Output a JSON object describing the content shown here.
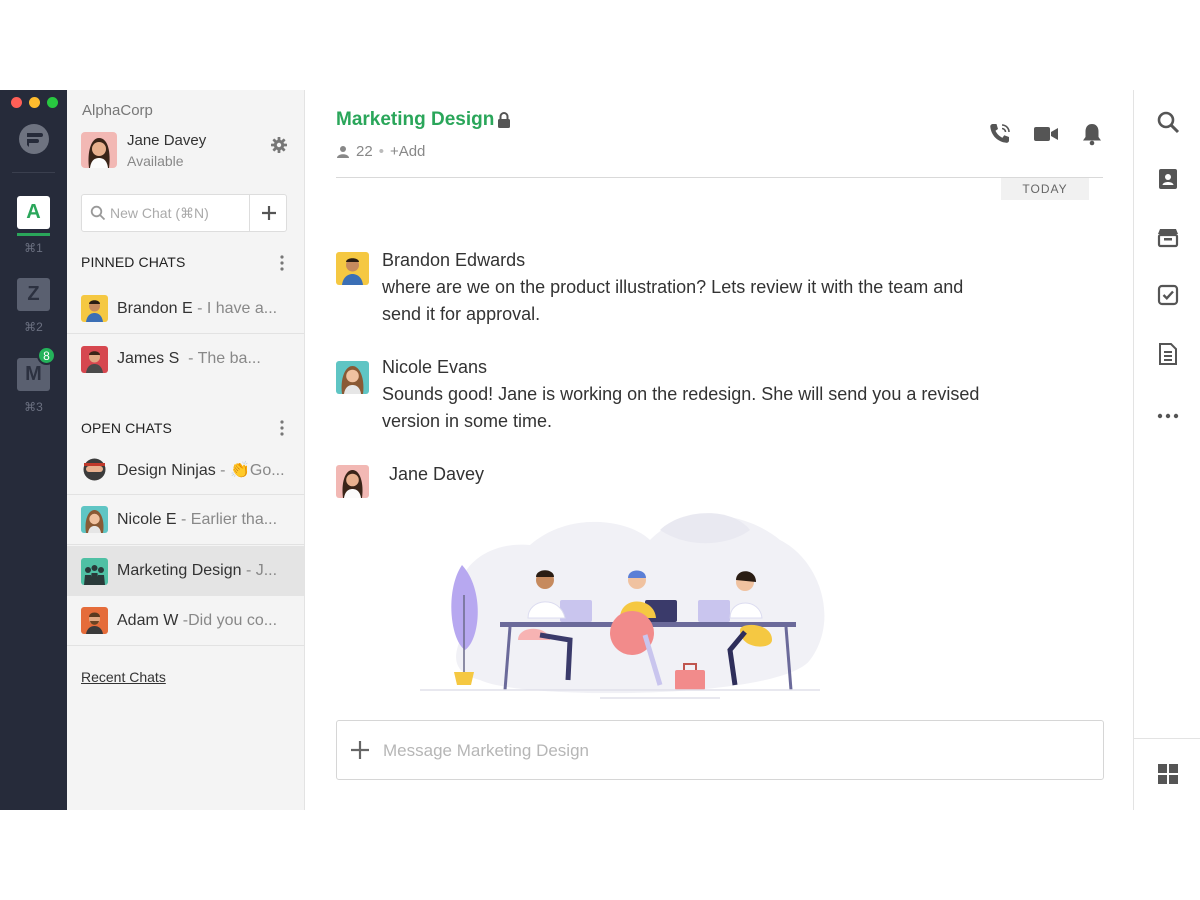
{
  "workspace_rail": {
    "items": [
      {
        "letter": "A",
        "shortcut": "⌘1",
        "bg": "#ffffff",
        "fg": "#2aa65a",
        "active": true
      },
      {
        "letter": "Z",
        "shortcut": "⌘2",
        "bg": "#5a6070",
        "fg": "#2c3140",
        "active": false
      },
      {
        "letter": "M",
        "shortcut": "⌘3",
        "bg": "#5a6070",
        "fg": "#2c3140",
        "active": false,
        "badge": "8"
      }
    ]
  },
  "sidebar": {
    "org_name": "AlphaCorp",
    "user": {
      "name": "Jane Davey",
      "status": "Available"
    },
    "search": {
      "placeholder": "New Chat (⌘N)"
    },
    "pinned": {
      "title": "PINNED CHATS",
      "items": [
        {
          "name": "Brandon E",
          "preview": "- I have a..."
        },
        {
          "name": "James S",
          "preview": "- The ba..."
        }
      ]
    },
    "open": {
      "title": "OPEN CHATS",
      "items": [
        {
          "name": "Design Ninjas",
          "preview": "- 👏Go..."
        },
        {
          "name": "Nicole E",
          "preview": "- Earlier tha..."
        },
        {
          "name": "Marketing Design",
          "preview": "- J..."
        },
        {
          "name": "Adam W",
          "preview": "-Did you co..."
        }
      ]
    },
    "recent_label": "Recent Chats"
  },
  "channel": {
    "title": "Marketing Design",
    "member_count": "22",
    "add_label": "+Add",
    "date_divider": "TODAY",
    "messages": [
      {
        "author": "Brandon Edwards",
        "text": "where are we on the product illustration? Lets review it with the team and send it for approval."
      },
      {
        "author": "Nicole Evans",
        "text": "Sounds good! Jane is working on the redesign. She will send you a revised version in some time."
      },
      {
        "author": "Jane Davey",
        "text": ""
      }
    ],
    "composer_placeholder": "Message Marketing Design"
  },
  "colors": {
    "accent": "#2aa65a",
    "rail_bg": "#262b3a",
    "badge": "#24b35a"
  },
  "icons": {
    "header": [
      "phone-icon",
      "video-icon",
      "bell-icon"
    ],
    "toolbar": [
      "search-icon",
      "contacts-icon",
      "archive-icon",
      "tasks-icon",
      "notes-icon",
      "more-icon",
      "apps-grid-icon"
    ]
  }
}
